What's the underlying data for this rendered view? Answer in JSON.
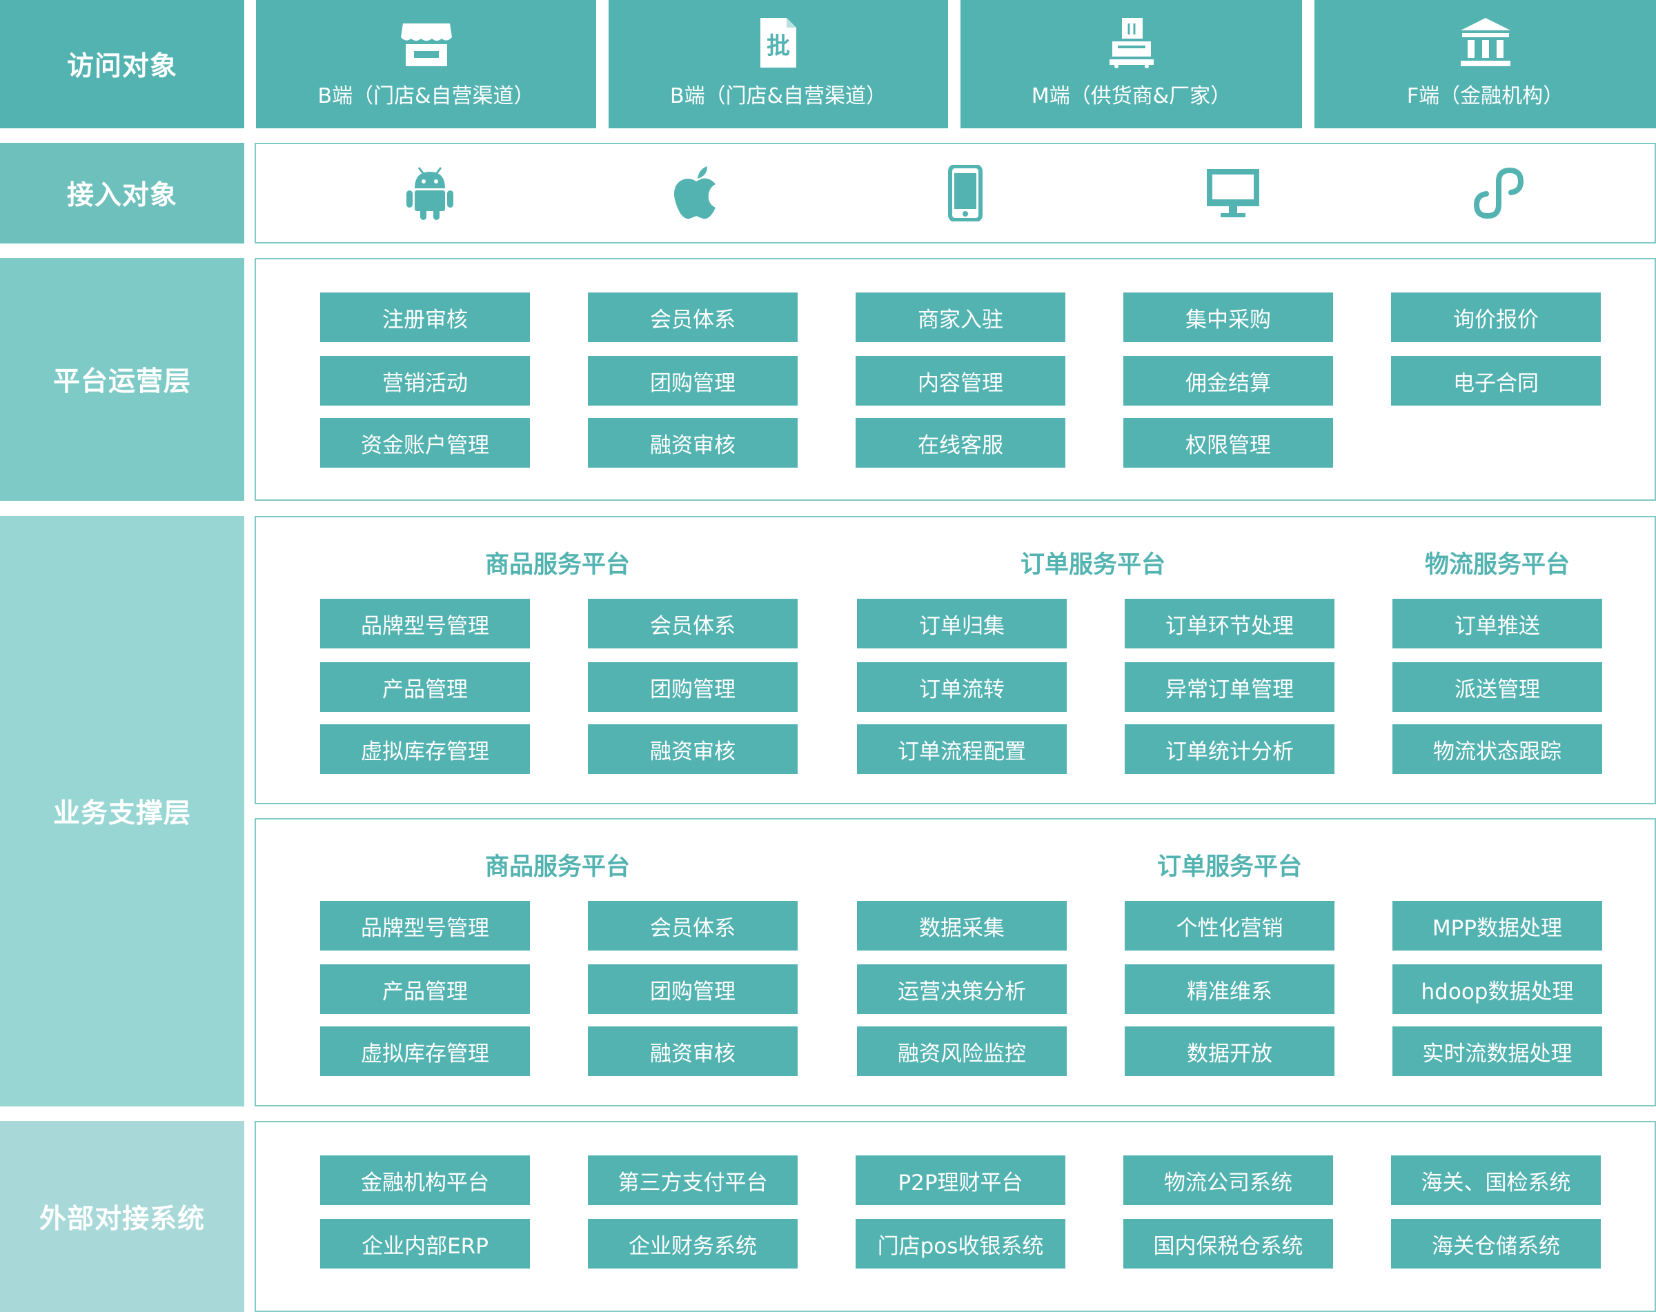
{
  "colors": {
    "teal": "#53b3b1",
    "panel_border": "#7ecac6",
    "row_access": "#53b3b1",
    "row_access_device": "#6ec0bc",
    "row_platform_ops": "#7ecac6",
    "row_business": "#98d6d3",
    "row_external": "#a8d8d8"
  },
  "rows": {
    "access": "访问对象",
    "access_device": "接入对象",
    "platform_ops": "平台运营层",
    "business": "业务支撑层",
    "external": "外部对接系统"
  },
  "access_tiles": [
    {
      "label": "B端（门店&自营渠道）",
      "icon": "store-icon"
    },
    {
      "label": "B端（门店&自营渠道）",
      "icon": "wholesale-document-icon",
      "icon_text": "批"
    },
    {
      "label": "M端（供货商&厂家）",
      "icon": "supplier-boxes-icon"
    },
    {
      "label": "F端（金融机构）",
      "icon": "bank-icon"
    }
  ],
  "access_devices": [
    "android-icon",
    "apple-icon",
    "mobile-phone-icon",
    "desktop-monitor-icon",
    "mini-program-icon"
  ],
  "platform_ops": {
    "columns": [
      [
        "注册审核",
        "营销活动",
        "资金账户管理"
      ],
      [
        "会员体系",
        "团购管理",
        "融资审核"
      ],
      [
        "商家入驻",
        "内容管理",
        "在线客服"
      ],
      [
        "集中采购",
        "佣金结算",
        "权限管理"
      ],
      [
        "询价报价",
        "电子合同"
      ]
    ]
  },
  "business_a": {
    "headings": [
      "商品服务平台",
      "订单服务平台",
      "物流服务平台"
    ],
    "columns": [
      [
        "品牌型号管理",
        "产品管理",
        "虚拟库存管理"
      ],
      [
        "会员体系",
        "团购管理",
        "融资审核"
      ],
      [
        "订单归集",
        "订单流转",
        "订单流程配置"
      ],
      [
        "订单环节处理",
        "异常订单管理",
        "订单统计分析"
      ],
      [
        "订单推送",
        "派送管理",
        "物流状态跟踪"
      ]
    ]
  },
  "business_b": {
    "headings": [
      "商品服务平台",
      "订单服务平台"
    ],
    "columns": [
      [
        "品牌型号管理",
        "产品管理",
        "虚拟库存管理"
      ],
      [
        "会员体系",
        "团购管理",
        "融资审核"
      ],
      [
        "数据采集",
        "运营决策分析",
        "融资风险监控"
      ],
      [
        "个性化营销",
        "精准维系",
        "数据开放"
      ],
      [
        "MPP数据处理",
        "hdoop数据处理",
        "实时流数据处理"
      ]
    ]
  },
  "external": {
    "columns": [
      [
        "金融机构平台",
        "企业内部ERP"
      ],
      [
        "第三方支付平台",
        "企业财务系统"
      ],
      [
        "P2P理财平台",
        "门店pos收银系统"
      ],
      [
        "物流公司系统",
        "国内保税仓系统"
      ],
      [
        "海关、国检系统",
        "海关仓储系统"
      ]
    ]
  }
}
